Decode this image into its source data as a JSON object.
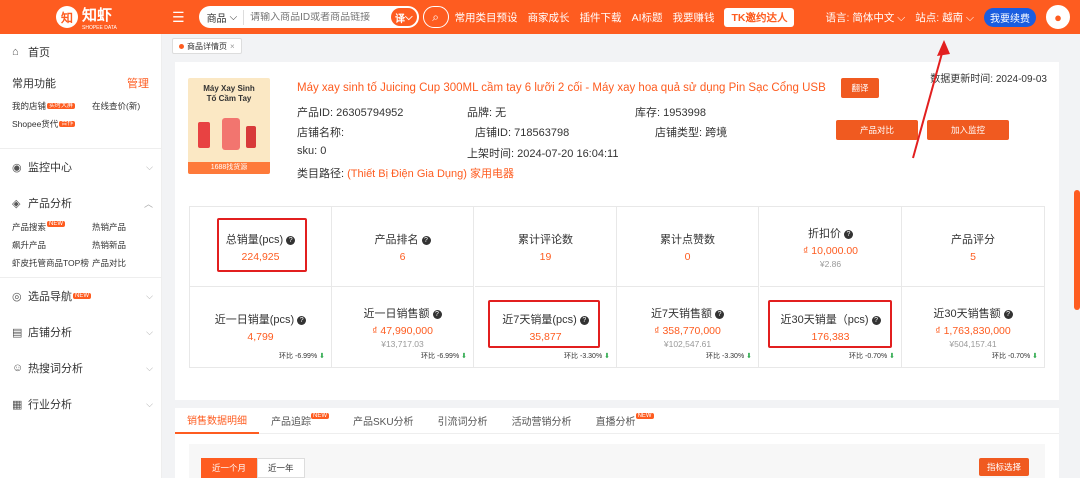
{
  "topbar": {
    "logo_mark": "知",
    "logo_text": "知虾",
    "logo_sub": "SHOPEE DATA",
    "menu_icon": "hamburger-icon",
    "search_type": "商品",
    "search_placeholder": "请输入商品ID或者商品链接",
    "search_badge": "译",
    "nav": [
      "常用类目预设",
      "商家成长",
      "插件下载",
      "AI标题",
      "我要赚钱"
    ],
    "tk_button": "TK邀约达人",
    "language_label": "语言: 简体中文",
    "site_label": "站点: 越南",
    "renew_button": "我要续费"
  },
  "sidebar": {
    "home": "首页",
    "common_functions": "常用功能",
    "manage": "管理",
    "quick_links": [
      {
        "label": "我的店铺",
        "tag": "实时大屏"
      },
      {
        "label": "在线查价(新)",
        "tag": ""
      },
      {
        "label": "Shopee货代",
        "tag": "合作"
      }
    ],
    "monitor_center": "监控中心",
    "product_analysis": "产品分析",
    "product_links": [
      "产品搜索",
      "热销产品",
      "飙升产品",
      "热销新品",
      "虾皮托管商品TOP榜",
      "产品对比"
    ],
    "product_search_tag": "NEW",
    "selection_nav": "选品导航",
    "selection_tag": "NEW",
    "shop_analysis": "店铺分析",
    "hot_keyword": "热搜词分析",
    "industry_analysis": "行业分析"
  },
  "page_tab": "商品详情页",
  "product": {
    "thumb_text": "Máy Xay Sinh Tố Cầm Tay",
    "thumb_strip": "1688找货源",
    "title": "Máy xay sinh tố Juicing Cup 300ML cầm tay 6 lưỡi 2 cối - Máy xay hoa quả sử dụng Pin Sạc Cổng USB",
    "translate_button": "翻译",
    "update_label": "数据更新时间: 2024-09-03",
    "product_id_label": "产品ID:",
    "product_id": "26305794952",
    "brand_label": "品牌:",
    "brand": "无",
    "stock_label": "库存:",
    "stock": "1953998",
    "shop_name_label": "店铺名称:",
    "shop_name": "",
    "shop_id_label": "店铺ID:",
    "shop_id": "718563798",
    "shop_type_label": "店铺类型:",
    "shop_type": "跨境",
    "sku_label": "sku:",
    "sku": "0",
    "listed_label": "上架时间:",
    "listed": "2024-07-20 16:04:11",
    "category_label": "类目路径:",
    "category": "(Thiết Bị Điện Gia Dụng) 家用电器",
    "compare_button": "产品对比",
    "monitor_button": "加入监控"
  },
  "stats": {
    "row1": [
      {
        "label": "总销量(pcs)",
        "value": "224,925",
        "sub": ""
      },
      {
        "label": "产品排名",
        "value": "6",
        "sub": ""
      },
      {
        "label": "累计评论数",
        "value": "19",
        "sub": ""
      },
      {
        "label": "累计点赞数",
        "value": "0",
        "sub": ""
      },
      {
        "label": "折扣价",
        "value": "₫ 10,000.00",
        "sub": "¥2.86"
      },
      {
        "label": "产品评分",
        "value": "5",
        "sub": ""
      }
    ],
    "row2": [
      {
        "label": "近一日销量(pcs)",
        "value": "4,799",
        "sub": "",
        "ratio": "-6.99%"
      },
      {
        "label": "近一日销售额",
        "value": "₫ 47,990,000",
        "sub": "¥13,717.03",
        "ratio": "-6.99%"
      },
      {
        "label": "近7天销量(pcs)",
        "value": "35,877",
        "sub": "",
        "ratio": "-3.30%"
      },
      {
        "label": "近7天销售额",
        "value": "₫ 358,770,000",
        "sub": "¥102,547.61",
        "ratio": "-3.30%"
      },
      {
        "label": "近30天销量（pcs)",
        "value": "176,383",
        "sub": "",
        "ratio": "-0.70%"
      },
      {
        "label": "近30天销售额",
        "value": "₫ 1,763,830,000",
        "sub": "¥504,157.41",
        "ratio": "-0.70%"
      }
    ],
    "ratio_label": "环比"
  },
  "bottom": {
    "tabs": [
      {
        "label": "销售数据明细",
        "tag": ""
      },
      {
        "label": "产品追踪",
        "tag": "NEW"
      },
      {
        "label": "产品SKU分析",
        "tag": ""
      },
      {
        "label": "引流词分析",
        "tag": ""
      },
      {
        "label": "活动营销分析",
        "tag": ""
      },
      {
        "label": "直播分析",
        "tag": "NEW"
      }
    ],
    "range_month": "近一个月",
    "range_year": "近一年",
    "pick_button": "指标选择"
  }
}
